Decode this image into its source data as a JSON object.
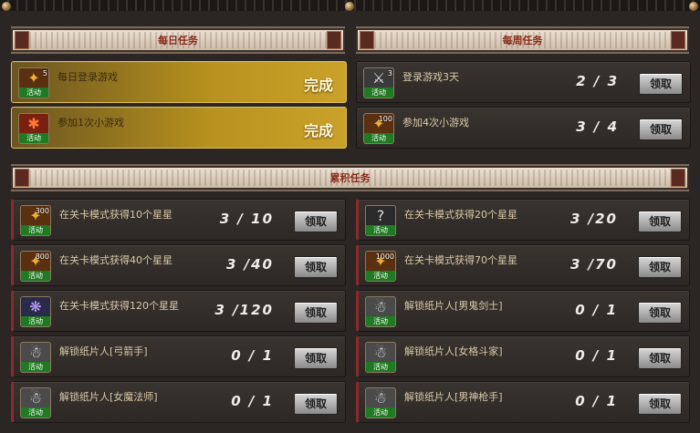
{
  "sections": {
    "daily": "每日任务",
    "weekly": "每周任务",
    "cumulative": "累积任务"
  },
  "daily": [
    {
      "name": "每日登录游戏",
      "icon_num": "5",
      "icon_tag": "活动",
      "status": "完成"
    },
    {
      "name": "参加1次小游戏",
      "icon_num": "",
      "icon_tag": "活动",
      "status": "完成"
    }
  ],
  "weekly": [
    {
      "name": "登录游戏3天",
      "icon_num": "3",
      "icon_tag": "活动",
      "progress": "2 / 3",
      "button": "领取"
    },
    {
      "name": "参加4次小游戏",
      "icon_num": "100",
      "icon_tag": "活动",
      "progress": "3 / 4",
      "button": "领取"
    }
  ],
  "cumulative_left": [
    {
      "name": "在关卡模式获得10个星星",
      "icon_num": "300",
      "icon_tag": "活动",
      "progress": "3 / 10",
      "button": "领取"
    },
    {
      "name": "在关卡模式获得40个星星",
      "icon_num": "800",
      "icon_tag": "活动",
      "progress": "3 /40",
      "button": "领取"
    },
    {
      "name": "在关卡模式获得120个星星",
      "icon_num": "",
      "icon_tag": "活动",
      "progress": "3 /120",
      "button": "领取"
    },
    {
      "name": "解锁纸片人[弓箭手]",
      "icon_num": "",
      "icon_tag": "活动",
      "progress": "0 / 1",
      "button": "领取"
    },
    {
      "name": "解锁纸片人[女魔法师]",
      "icon_num": "",
      "icon_tag": "活动",
      "progress": "0 / 1",
      "button": "领取"
    }
  ],
  "cumulative_right": [
    {
      "name": "在关卡模式获得20个星星",
      "icon_num": "",
      "icon_tag": "活动",
      "progress": "3 /20",
      "button": "领取"
    },
    {
      "name": "在关卡模式获得70个星星",
      "icon_num": "1000",
      "icon_tag": "活动",
      "progress": "3 /70",
      "button": "领取"
    },
    {
      "name": "解锁纸片人[男鬼剑士]",
      "icon_num": "",
      "icon_tag": "活动",
      "progress": "0 / 1",
      "button": "领取"
    },
    {
      "name": "解锁纸片人[女格斗家]",
      "icon_num": "",
      "icon_tag": "活动",
      "progress": "0 / 1",
      "button": "领取"
    },
    {
      "name": "解锁纸片人[男神枪手]",
      "icon_num": "",
      "icon_tag": "活动",
      "progress": "0 / 1",
      "button": "领取"
    }
  ],
  "colors": {
    "gold": "#caa22a",
    "banner_text": "#8a2a1a",
    "tag_green": "#1f7a22"
  }
}
